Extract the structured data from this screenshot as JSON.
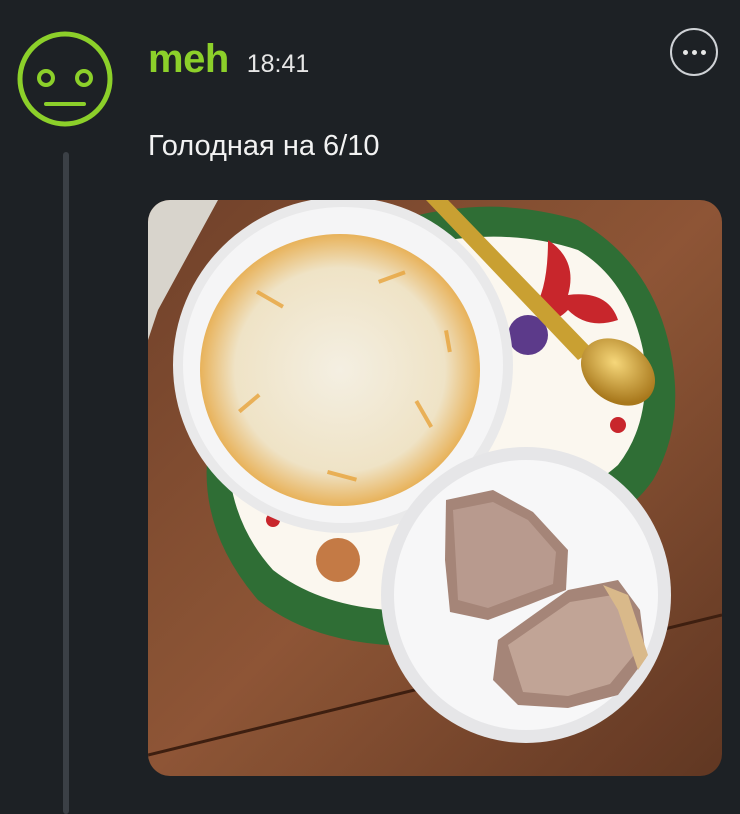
{
  "post": {
    "username": "meh",
    "time": "18:41",
    "text": "Голодная на 6/10",
    "avatar_icon": "neutral-face-icon",
    "more_icon": "more-horizontal-icon",
    "photo": {
      "description_icon": "food-photo-icon"
    }
  },
  "colors": {
    "background": "#1d2125",
    "accent": "#8cd02a",
    "text": "#f2f2f2",
    "thread_line": "#3b4046"
  }
}
